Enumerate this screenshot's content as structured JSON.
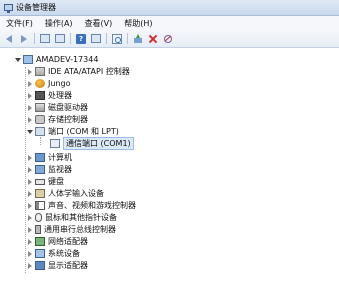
{
  "window": {
    "title": "设备管理器"
  },
  "menu": [
    {
      "label": "文件(F)"
    },
    {
      "label": "操作(A)"
    },
    {
      "label": "查看(V)"
    },
    {
      "label": "帮助(H)"
    }
  ],
  "toolbar": {
    "icons": [
      "back-arrow-icon",
      "forward-arrow-icon",
      "show-hide-console-tree-icon",
      "properties-icon",
      "help-icon",
      "device-list-icon",
      "scan-hardware-icon",
      "update-driver-icon",
      "uninstall-icon",
      "disable-device-icon"
    ]
  },
  "tree": {
    "root": {
      "label": "AMADEV-17344",
      "expanded": true
    },
    "categories": [
      {
        "label": "IDE ATA/ATAPI 控制器",
        "icon": "ide-controller-icon",
        "expanded": false
      },
      {
        "label": "Jungo",
        "icon": "jungo-icon",
        "expanded": false
      },
      {
        "label": "处理器",
        "icon": "processor-icon",
        "expanded": false
      },
      {
        "label": "磁盘驱动器",
        "icon": "disk-drive-icon",
        "expanded": false
      },
      {
        "label": "存储控制器",
        "icon": "storage-controller-icon",
        "expanded": false
      },
      {
        "label": "端口 (COM 和 LPT)",
        "icon": "port-icon",
        "expanded": true,
        "children": [
          {
            "label": "通信端口 (COM1)",
            "selected": true
          }
        ]
      },
      {
        "label": "计算机",
        "icon": "computer-icon",
        "expanded": false
      },
      {
        "label": "监视器",
        "icon": "monitor-icon",
        "expanded": false
      },
      {
        "label": "键盘",
        "icon": "keyboard-icon",
        "expanded": false
      },
      {
        "label": "人体学输入设备",
        "icon": "hid-icon",
        "expanded": false
      },
      {
        "label": "声音、视频和游戏控制器",
        "icon": "sound-icon",
        "expanded": false
      },
      {
        "label": "鼠标和其他指针设备",
        "icon": "mouse-icon",
        "expanded": false
      },
      {
        "label": "通用串行总线控制器",
        "icon": "usb-icon",
        "expanded": false
      },
      {
        "label": "网络适配器",
        "icon": "network-adapter-icon",
        "expanded": false
      },
      {
        "label": "系统设备",
        "icon": "system-device-icon",
        "expanded": false
      },
      {
        "label": "显示适配器",
        "icon": "display-adapter-icon",
        "expanded": false
      }
    ]
  }
}
